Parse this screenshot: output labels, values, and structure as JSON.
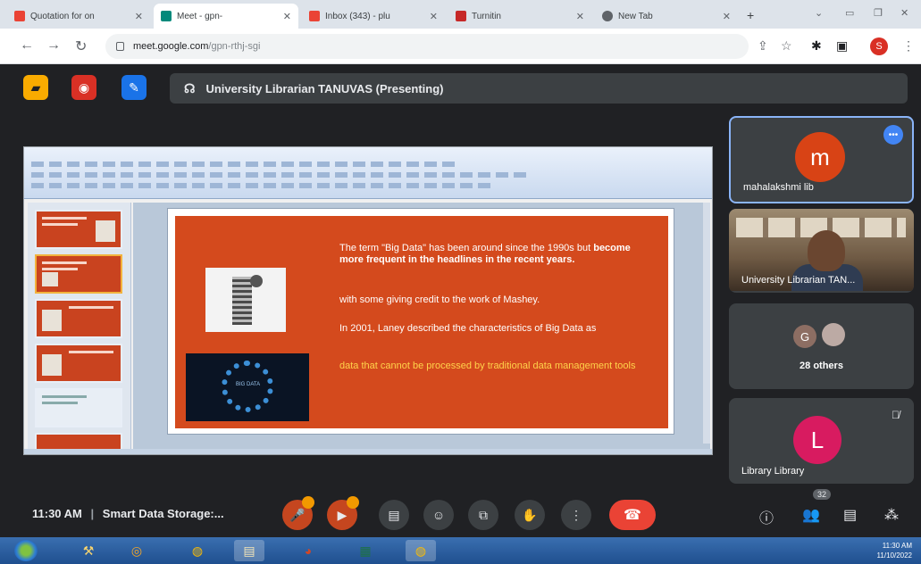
{
  "browser": {
    "tabs": [
      {
        "label": "Quotation for on",
        "icon": "gmail-icon",
        "active": false
      },
      {
        "label": "Meet - gpn-",
        "icon": "meet-icon",
        "active": true
      },
      {
        "label": "Inbox (343) - plu",
        "icon": "gmail-icon",
        "active": false
      },
      {
        "label": "Turnitin",
        "icon": "turnitin-icon",
        "active": false
      },
      {
        "label": "New Tab",
        "icon": "chrome-icon",
        "active": false
      }
    ],
    "url_host": "meet.google.com",
    "url_path": "/gpn-rthj-sgi",
    "profile_initial": "S"
  },
  "meet": {
    "presenting_label": "University Librarian TANUVAS (Presenting)",
    "time": "11:30 AM",
    "separator": "|",
    "meeting_title": "Smart Data Storage:...",
    "participant_count": "32"
  },
  "slide": {
    "para1_normal": "The term \"Big Data\" has been around since the 1990s but ",
    "para1_bold": "become more frequent in the headlines in the recent years.",
    "para2": "with some giving credit to the work of Mashey.",
    "para3": "In 2001, Laney described the characteristics of Big Data as",
    "para4": "data that cannot be processed by traditional data management tools",
    "image_caption": "BIG DATA"
  },
  "participants": {
    "tile1": {
      "initial": "m",
      "name": "mahalakshmi lib",
      "color": "#d84315",
      "more_icon": "more-icon"
    },
    "tile2": {
      "name": "University Librarian TAN..."
    },
    "tile3": {
      "initial": "G",
      "label": "28 others"
    },
    "tile4": {
      "initial": "L",
      "name": "Library Library",
      "color": "#d81b60"
    }
  },
  "taskbar": {
    "clock": "11:30 AM",
    "date": "11/10/2022"
  },
  "colors": {
    "meet_bg": "#202124",
    "slide_orange": "#d44a1d",
    "slide_highlight": "#ffd34a",
    "end_call_red": "#ea4335"
  }
}
